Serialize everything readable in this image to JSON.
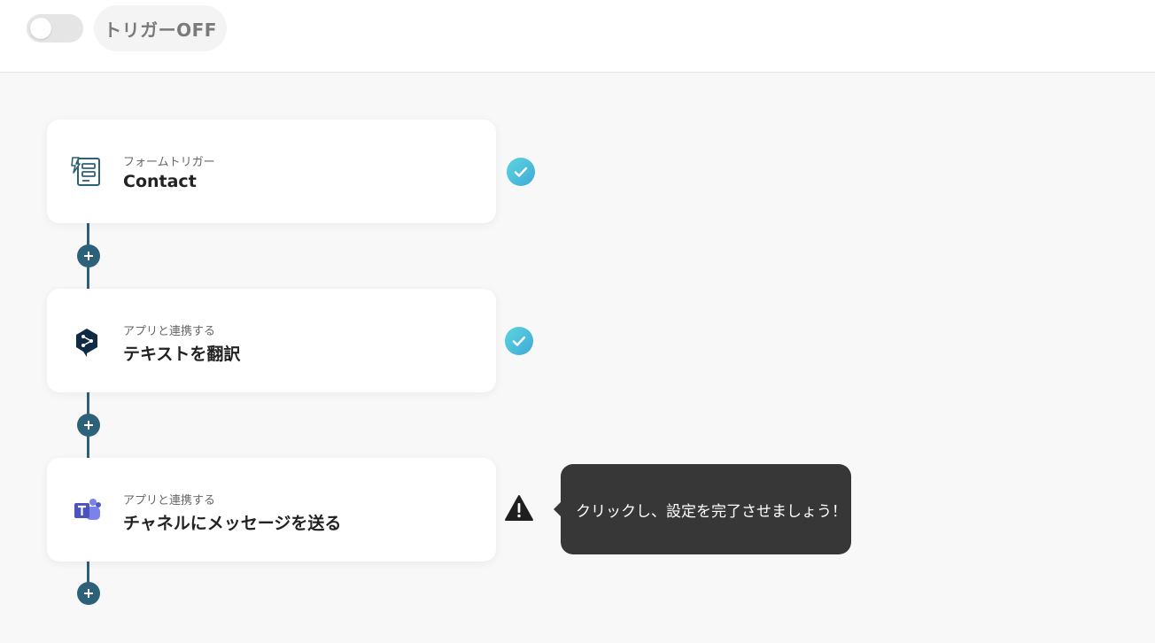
{
  "header": {
    "trigger_toggle_state": "off",
    "trigger_label": "トリガーOFF"
  },
  "flow": {
    "steps": [
      {
        "sub": "フォームトリガー",
        "title": "Contact",
        "icon": "form-icon",
        "status": "complete"
      },
      {
        "sub": "アプリと連携する",
        "title": "テキストを翻訳",
        "icon": "deepl-icon",
        "status": "complete"
      },
      {
        "sub": "アプリと連携する",
        "title": "チャネルにメッセージを送る",
        "icon": "teams-icon",
        "status": "warning"
      }
    ]
  },
  "tooltip": {
    "text": "クリックし、設定を完了させましょう！"
  },
  "colors": {
    "connector": "#2d6179",
    "check_start": "#5dd5dd",
    "check_end": "#3fa9d8",
    "tooltip_bg": "#373737"
  }
}
